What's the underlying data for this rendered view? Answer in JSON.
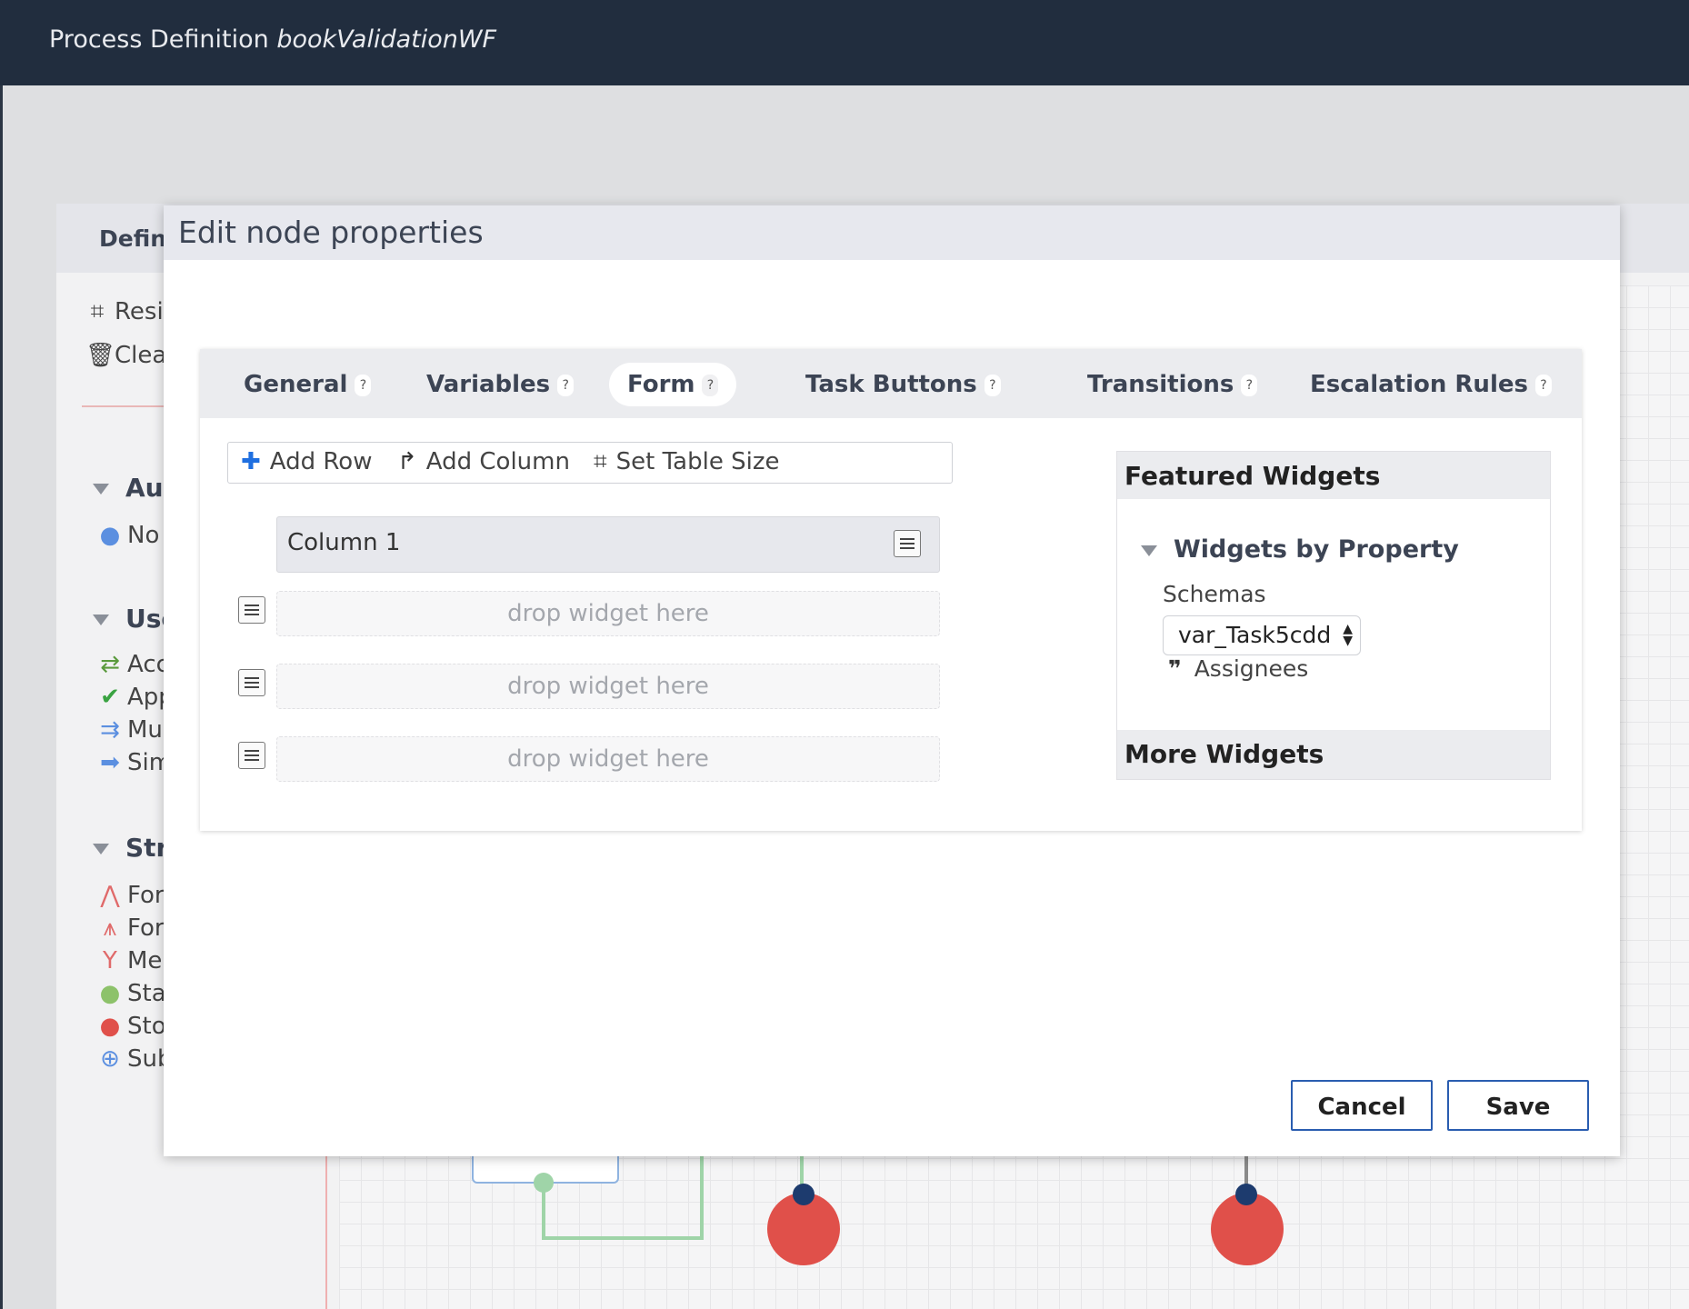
{
  "header": {
    "title_prefix": "Process Definition",
    "title_name": "bookValidationWF"
  },
  "background": {
    "panel_title": "Defin",
    "tools": [
      {
        "icon": "resize-icon",
        "label": "Resi"
      },
      {
        "icon": "trash-icon",
        "label": "Clea"
      }
    ],
    "sections": [
      {
        "title": "Aut",
        "items": [
          {
            "icon": "blue-circle-icon",
            "label": "No"
          }
        ]
      },
      {
        "title": "Use",
        "items": [
          {
            "icon": "exchange-icon",
            "label": "Acc"
          },
          {
            "icon": "check-icon",
            "label": "App"
          },
          {
            "icon": "multi-arrow-icon",
            "label": "Mu"
          },
          {
            "icon": "arrow-right-icon",
            "label": "Sim"
          }
        ]
      },
      {
        "title": "Str",
        "items": [
          {
            "icon": "fork-icon",
            "label": "For"
          },
          {
            "icon": "fork-multi-icon",
            "label": "For"
          },
          {
            "icon": "merge-icon",
            "label": "Me"
          },
          {
            "icon": "start-circle-icon",
            "label": "Sta"
          },
          {
            "icon": "stop-circle-icon",
            "label": "Sto"
          },
          {
            "icon": "subprocess-icon",
            "label": "Sub"
          }
        ]
      }
    ]
  },
  "dialog": {
    "title": "Edit node properties",
    "tabs": [
      {
        "label": "General",
        "help": "?"
      },
      {
        "label": "Variables",
        "help": "?"
      },
      {
        "label": "Form",
        "help": "?"
      },
      {
        "label": "Task Buttons",
        "help": "?"
      },
      {
        "label": "Transitions",
        "help": "?"
      },
      {
        "label": "Escalation Rules",
        "help": "?"
      }
    ],
    "active_tab": "Form",
    "toolbar": {
      "add_row": "Add Row",
      "add_column": "Add Column",
      "set_table_size": "Set Table Size"
    },
    "table": {
      "column_header": "Column 1",
      "rows": [
        "drop widget here",
        "drop widget here",
        "drop widget here"
      ]
    },
    "widgets": {
      "featured_title": "Featured Widgets",
      "group_title": "Widgets by Property",
      "schemas_label": "Schemas",
      "schema_selected": "var_Task5cdd",
      "items": [
        "Assignees"
      ],
      "more_title": "More Widgets"
    },
    "buttons": {
      "cancel": "Cancel",
      "save": "Save"
    }
  },
  "colors": {
    "header_bg": "#212d3e",
    "accent_blue": "#2a5db0",
    "add_icon_blue": "#1f6fe0",
    "stop_red": "#e0504a",
    "start_green": "#8dc26a"
  }
}
